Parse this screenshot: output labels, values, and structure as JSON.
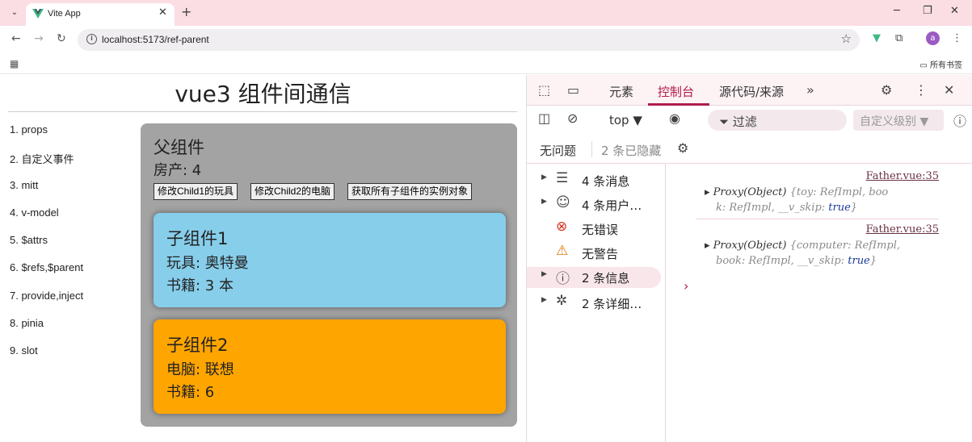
{
  "browser": {
    "tab_title": "Vite App",
    "url": "localhost:5173/ref-parent",
    "bookmarks_all": "所有书签"
  },
  "page": {
    "title": "vue3 组件间通信",
    "nav": [
      "1. props",
      "2. 自定义事件",
      "3. mitt",
      "4. v-model",
      "5. $attrs",
      "6. $refs,$parent",
      "7. provide,inject",
      "8. pinia",
      "9. slot"
    ],
    "parent": {
      "title": "父组件",
      "house": "房产: 4",
      "buttons": [
        "修改Child1的玩具",
        "修改Child2的电脑",
        "获取所有子组件的实例对象"
      ]
    },
    "child1": {
      "title": "子组件1",
      "toy": "玩具: 奥特曼",
      "book": "书籍: 3 本"
    },
    "child2": {
      "title": "子组件2",
      "computer": "电脑: 联想",
      "book": "书籍: 6"
    }
  },
  "devtools": {
    "tabs": [
      "元素",
      "控制台",
      "源代码/来源"
    ],
    "active_tab": "控制台",
    "context": "top ▼",
    "filter": "过滤",
    "level": "自定义级别 ▼",
    "no_issues": "无问题",
    "hidden": "2 条已隐藏",
    "sidebar": [
      {
        "icon": "list-icon",
        "glyph": "☰",
        "label": "4 条消息",
        "arrow": true
      },
      {
        "icon": "user-icon",
        "glyph": "☺",
        "label": "4 条用户…",
        "arrow": true
      },
      {
        "icon": "error-icon",
        "glyph": "⊗",
        "label": "无错误",
        "arrow": false
      },
      {
        "icon": "warning-icon",
        "glyph": "⚠",
        "label": "无警告",
        "arrow": false
      },
      {
        "icon": "info-icon",
        "glyph": "ⓘ",
        "label": "2 条信息",
        "arrow": true
      },
      {
        "icon": "bug-icon",
        "glyph": "✲",
        "label": "2 条详细…",
        "arrow": true
      }
    ],
    "messages": [
      {
        "source": "Father.vue:35",
        "line1_a": "▸ Proxy(Object) ",
        "line1_b": "{toy: RefImpl, boo",
        "line2_a": "k: RefImpl, __v_skip: ",
        "line2_b": "true",
        "line2_c": "}"
      },
      {
        "source": "Father.vue:35",
        "line1_a": "▸ Proxy(Object) ",
        "line1_b": "{computer: RefImpl,",
        "line2_a": "book: RefImpl, __v_skip: ",
        "line2_b": "true",
        "line2_c": "}"
      }
    ],
    "prompt": "›"
  },
  "colors": {
    "child1_bg": "#87ceeb",
    "child2_bg": "#ffa500",
    "parent_bg": "#a3a3a3",
    "devtools_accent": "#b01c4d",
    "tabstrip_bg": "#fbdde4"
  }
}
